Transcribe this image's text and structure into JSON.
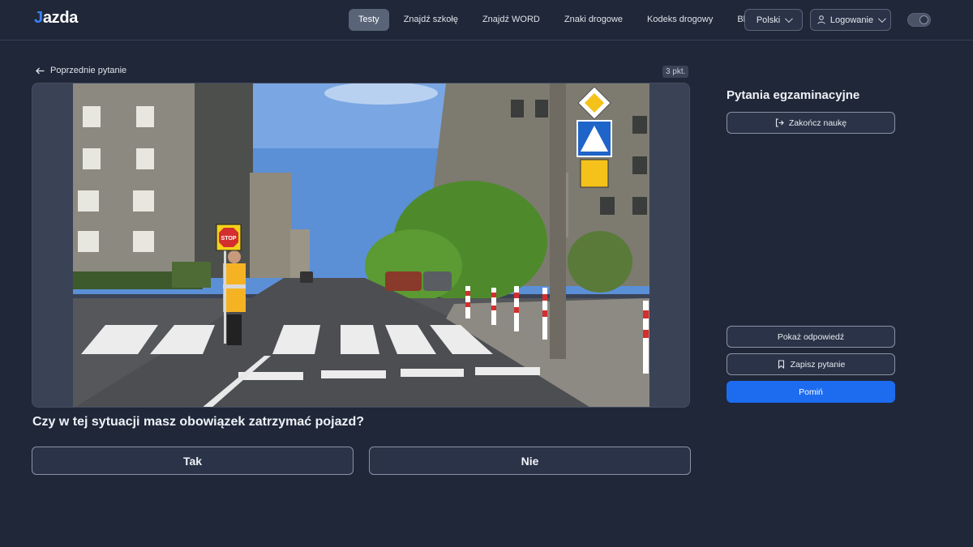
{
  "header": {
    "logo_text": "azda",
    "logo_letter": "J",
    "nav": [
      {
        "label": "Testy",
        "active": true
      },
      {
        "label": "Znajdź szkołę",
        "active": false
      },
      {
        "label": "Znajdź WORD",
        "active": false
      },
      {
        "label": "Znaki drogowe",
        "active": false
      },
      {
        "label": "Kodeks drogowy",
        "active": false
      },
      {
        "label": "Blog",
        "active": false
      }
    ],
    "language": "Polski",
    "login": "Logowanie",
    "theme_toggle_icon": "moon-icon"
  },
  "main": {
    "back_label": "Poprzednie pytanie",
    "points": "3 pkt.",
    "image_sign_text": "STOP",
    "question": "Czy w tej sytuacji masz obowiązek zatrzymać pojazd?",
    "answers": [
      "Tak",
      "Nie"
    ]
  },
  "sidebar": {
    "title": "Pytania egzaminacyjne",
    "finish_label": "Zakończ naukę",
    "show_answer_label": "Pokaż odpowiedź",
    "save_question_label": "Zapisz pytanie",
    "skip_label": "Pomiń"
  },
  "colors": {
    "background": "#1f2738",
    "accent": "#1d6cf0",
    "active_nav": "#5a6478"
  }
}
